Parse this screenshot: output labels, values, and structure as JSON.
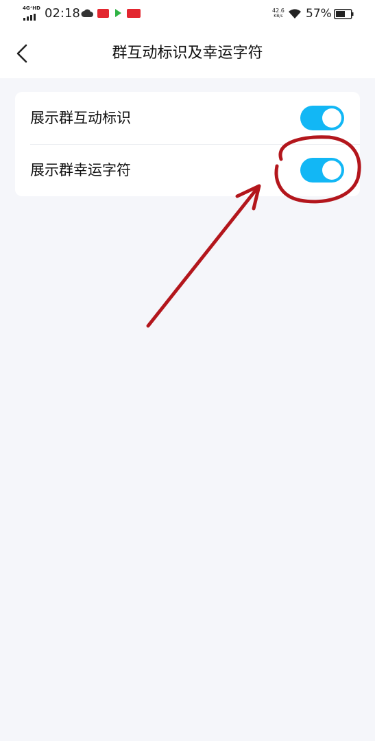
{
  "status_bar": {
    "network": "4G⁺HD",
    "time": "02:18",
    "speed_value": "42.6",
    "speed_unit": "KB/s",
    "battery": "57%"
  },
  "header": {
    "title": "群互动标识及幸运字符"
  },
  "settings": {
    "items": [
      {
        "label": "展示群互动标识",
        "enabled": true
      },
      {
        "label": "展示群幸运字符",
        "enabled": true
      }
    ]
  },
  "colors": {
    "toggle_on": "#12b7f5",
    "annotation": "#b3161c",
    "background": "#f5f6fa"
  },
  "icons": [
    "chevron-left-icon",
    "signal-icon",
    "cloud-icon",
    "wifi-icon",
    "battery-icon"
  ]
}
